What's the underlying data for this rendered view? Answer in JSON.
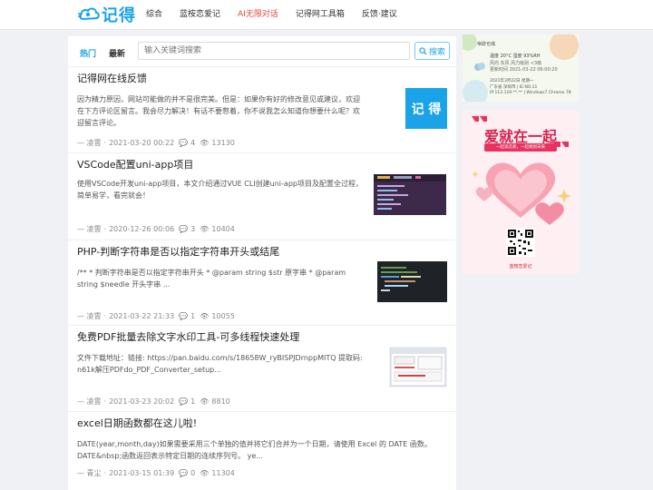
{
  "brand": {
    "name": "记得"
  },
  "nav": [
    "综合",
    "蓝桉恋爱记",
    "AI无限对话",
    "记得网工具箱",
    "反馈·建议"
  ],
  "tabs": {
    "hot": "热门",
    "new": "最新"
  },
  "search": {
    "placeholder": "输入关键词搜索",
    "button": "搜索"
  },
  "posts": [
    {
      "title": "记得网在线反馈",
      "excerpt": "因为精力原因，网站可能做的并不是很完美。但是：如果你有好的修改意见或建议，欢迎在下方评论区留言。我会尽力解决！有话不要憋着，你不说我怎么知道你想要什么呢？欢迎留言评论。",
      "author": "— 凌雲",
      "date": "2021-03-20 00:22",
      "comments": "4",
      "views": "13130",
      "thumb_text": "记 得"
    },
    {
      "title": "VSCode配置uni-app项目",
      "excerpt": "使用VSCode开发uni-app项目，本文介绍通过VUE CLI创建uni-app项目及配置全过程，简单易学，看完就会！",
      "author": "— 凌雲",
      "date": "2020-12-26 00:06",
      "comments": "3",
      "views": "10404"
    },
    {
      "title": "PHP-判断字符串是否以指定字符串开头或结尾",
      "excerpt": "/** * 判断字符串是否以指定字符串开头 * @param string $str 原字串 * @param string $needle 开头字串 ...",
      "author": "— 凌雲",
      "date": "2021-03-22 21:33",
      "comments": "1",
      "views": "10055"
    },
    {
      "title": "免费PDF批量去除文字水印工具-可多线程快速处理",
      "excerpt": "文件下载地址：链接: https://pan.baidu.com/s/18658W_ryBISPJDrnppMITQ 提取码: n61k解压PDFdo_PDF_Converter_setup...",
      "author": "— 凌雲",
      "date": "2021-03-23 20:02",
      "comments": "1",
      "views": "8810"
    },
    {
      "title": "excel日期函数都在这儿啦!",
      "excerpt": "DATE(year,month,day)如果需要采用三个单独的值并将它们合并为一个日期，请使用 Excel 的 DATE 函数。DATE&nbsp;函数返回表示特定日期的连续序列号。 ye...",
      "author": "— 青尘",
      "date": "2021-03-15 01:39",
      "comments": "0",
      "views": "11304"
    }
  ],
  "sidebar": {
    "weather_card": {
      "title": "帝辟也瑞",
      "temp": "温度 20°C 湿度 93%RH",
      "lines": [
        "风向 东风  风力级别 <3级",
        "更新时间 2021-03-22 06:00:20"
      ],
      "footer_lines": [
        "2021年3月22日 星期一",
        "广东省 深圳市 | IE:NO.11",
        "IP:113.119.**.** | Windows7 Chrome 78"
      ]
    },
    "love_ad": {
      "title": "爱就在一起",
      "subtitle": "一起谈恋爱，一起规划未来",
      "footer": "蓝桉恋爱记"
    }
  },
  "colors": {
    "brand": "#1aa3e8",
    "hot_nav": "#e8473b",
    "love_title": "#d81f4e"
  }
}
